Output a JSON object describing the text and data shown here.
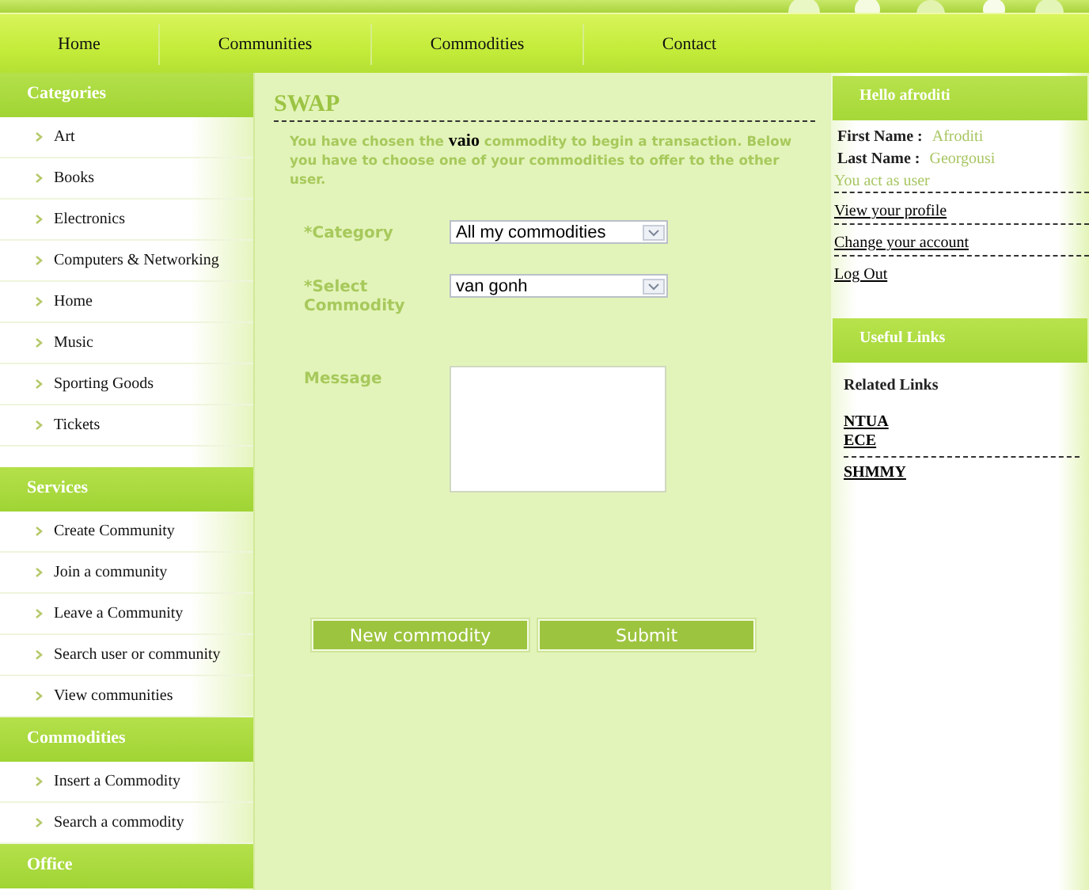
{
  "nav": [
    {
      "label": "Home"
    },
    {
      "label": "Communities"
    },
    {
      "label": "Commodities"
    },
    {
      "label": "Contact"
    }
  ],
  "sidebar": {
    "sections": [
      {
        "title": "Categories",
        "items": [
          "Art",
          "Books",
          "Electronics",
          "Computers & Networking",
          "Home",
          "Music",
          "Sporting Goods",
          "Tickets"
        ]
      },
      {
        "title": "Services",
        "items": [
          "Create Community",
          "Join a community",
          "Leave a Community",
          "Search user or community",
          "View communities"
        ]
      },
      {
        "title": "Commodities",
        "items": [
          "Insert a Commodity",
          "Search a commodity"
        ]
      },
      {
        "title": "Office"
      }
    ]
  },
  "main": {
    "title": "SWAP",
    "intro": "You have chosen the **vaio** commodity to begin a transaction. Below you have to choose one of your commodities to offer to the other user.",
    "fields": [
      {
        "kind": "select",
        "label": "*Category",
        "value": "All my commodities"
      },
      {
        "kind": "select",
        "label": "*Select Commodity",
        "value": "van gonh"
      },
      {
        "kind": "textarea",
        "label": "Message"
      }
    ],
    "buttons": [
      "New commodity",
      "Submit"
    ]
  },
  "user_panel": {
    "title": "Hello afroditi",
    "first_name_label": "First Name :",
    "first_name": "Afroditi",
    "last_name_label": "Last Name :",
    "last_name": "Georgousi",
    "role": "You act as user",
    "links": [
      "View your profile",
      "Change your account",
      "Log Out"
    ]
  },
  "useful_links": {
    "title": "Useful Links",
    "subtitle": "Related Links",
    "groups": [
      [
        "NTUA",
        "ECE"
      ],
      [
        "SHMMY"
      ]
    ]
  }
}
